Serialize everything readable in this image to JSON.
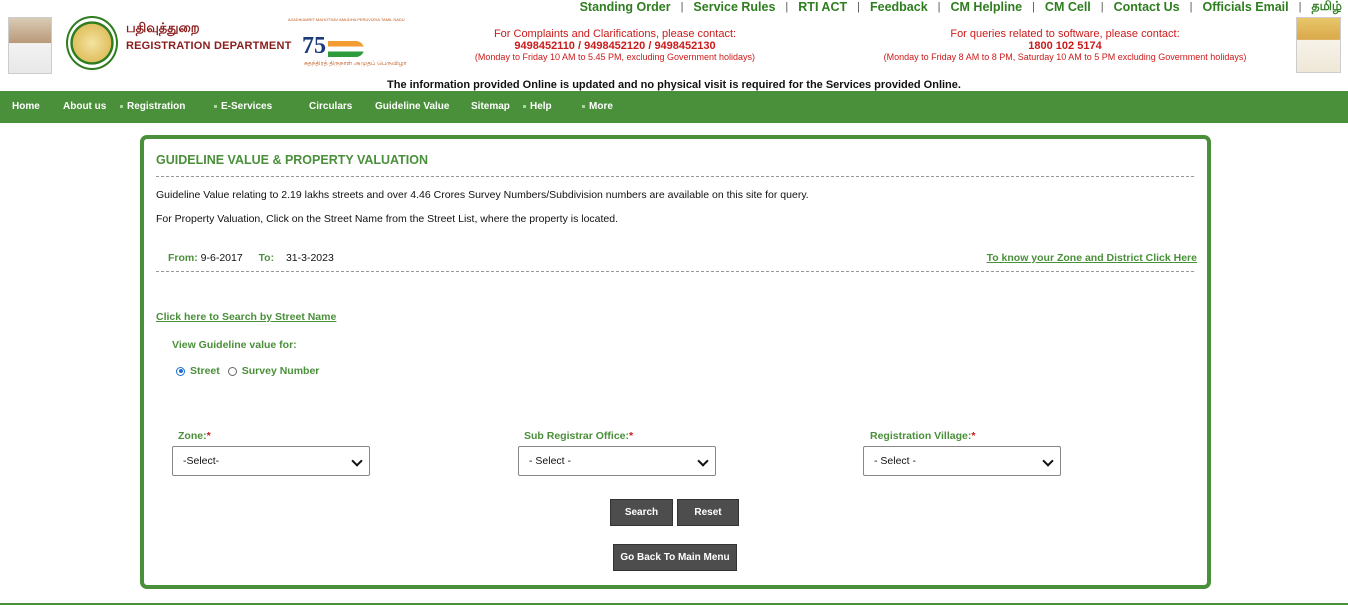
{
  "top_links": [
    "Standing Order",
    "Service Rules",
    "RTI ACT",
    "Feedback",
    "CM Helpline",
    "CM Cell",
    "Contact Us",
    "Officials Email",
    "தமிழ்"
  ],
  "header": {
    "dept_tamil": "பதிவுத்துறை",
    "dept_english": "REGISTRATION DEPARTMENT",
    "azadi_small": "AZADIKAMRIT MAHOTSAV  AMUDHA PERUVIZHA  TAMIL NADU",
    "azadi_num": "75",
    "azadi_sub": "சுதந்திரத் திருநாள் அமுதப் பெருவிழா",
    "complaints": {
      "heading": "For Complaints and Clarifications, please contact:",
      "phones": "9498452110 / 9498452120 / 9498452130",
      "hours": "(Monday to Friday 10 AM to 5.45 PM, excluding Government holidays)"
    },
    "software": {
      "heading": "For queries related to software, please contact:",
      "phones": "1800 102 5174",
      "hours": "(Monday to Friday 8 AM to 8 PM, Saturday 10 AM to 5 PM excluding Government holidays)"
    },
    "notice": "The information provided Online is updated and no physical visit is required for the Services provided Online."
  },
  "nav": {
    "home": "Home",
    "about": "About us",
    "registration": "Registration",
    "eservices": "E-Services",
    "circulars": "Circulars",
    "guideline": "Guideline Value",
    "sitemap": "Sitemap",
    "help": "Help",
    "more": "More"
  },
  "main": {
    "title": "GUIDELINE VALUE & PROPERTY VALUATION",
    "para1": "Guideline Value relating to 2.19 lakhs streets and over 4.46 Crores Survey Numbers/Subdivision numbers are available on this site for query.",
    "para2": "For Property Valuation, Click on the Street Name from the Street List, where the property is located.",
    "from_label": "From:",
    "from_value": "9-6-2017",
    "to_label": "To:",
    "to_value": "31-3-2023",
    "zone_link": "To know your Zone and District Click Here",
    "street_link": "Click here to Search by Street Name",
    "view_for": "View Guideline value for:",
    "radio_street": "Street",
    "radio_survey": "Survey Number",
    "selected_radio": "Street",
    "zone_label": "Zone:",
    "zone_value": "-Select-",
    "sro_label": "Sub Registrar Office:",
    "sro_value": "- Select -",
    "village_label": "Registration Village:",
    "village_value": "- Select -",
    "required_mark": "*",
    "search_btn": "Search",
    "reset_btn": "Reset",
    "back_btn": "Go Back To Main Menu"
  },
  "colors": {
    "brand_green": "#4a8f3a",
    "contact_red": "#cc1a1a",
    "button_gray": "#4d4d4d"
  }
}
